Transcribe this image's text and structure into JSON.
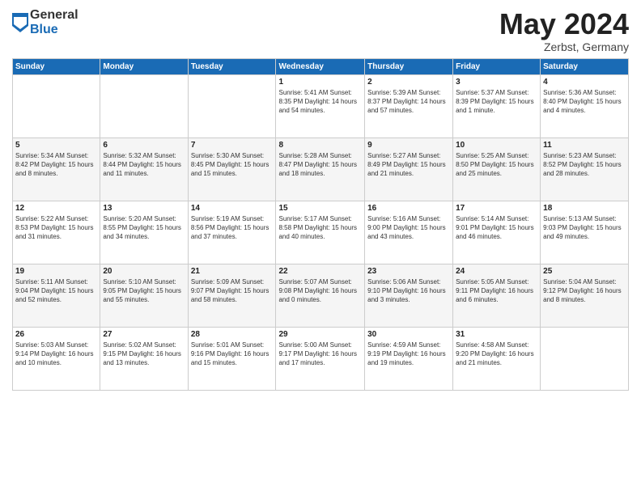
{
  "logo": {
    "general": "General",
    "blue": "Blue"
  },
  "title": {
    "month_year": "May 2024",
    "location": "Zerbst, Germany"
  },
  "days_of_week": [
    "Sunday",
    "Monday",
    "Tuesday",
    "Wednesday",
    "Thursday",
    "Friday",
    "Saturday"
  ],
  "weeks": [
    [
      {
        "day": "",
        "info": ""
      },
      {
        "day": "",
        "info": ""
      },
      {
        "day": "",
        "info": ""
      },
      {
        "day": "1",
        "info": "Sunrise: 5:41 AM\nSunset: 8:35 PM\nDaylight: 14 hours\nand 54 minutes."
      },
      {
        "day": "2",
        "info": "Sunrise: 5:39 AM\nSunset: 8:37 PM\nDaylight: 14 hours\nand 57 minutes."
      },
      {
        "day": "3",
        "info": "Sunrise: 5:37 AM\nSunset: 8:39 PM\nDaylight: 15 hours\nand 1 minute."
      },
      {
        "day": "4",
        "info": "Sunrise: 5:36 AM\nSunset: 8:40 PM\nDaylight: 15 hours\nand 4 minutes."
      }
    ],
    [
      {
        "day": "5",
        "info": "Sunrise: 5:34 AM\nSunset: 8:42 PM\nDaylight: 15 hours\nand 8 minutes."
      },
      {
        "day": "6",
        "info": "Sunrise: 5:32 AM\nSunset: 8:44 PM\nDaylight: 15 hours\nand 11 minutes."
      },
      {
        "day": "7",
        "info": "Sunrise: 5:30 AM\nSunset: 8:45 PM\nDaylight: 15 hours\nand 15 minutes."
      },
      {
        "day": "8",
        "info": "Sunrise: 5:28 AM\nSunset: 8:47 PM\nDaylight: 15 hours\nand 18 minutes."
      },
      {
        "day": "9",
        "info": "Sunrise: 5:27 AM\nSunset: 8:49 PM\nDaylight: 15 hours\nand 21 minutes."
      },
      {
        "day": "10",
        "info": "Sunrise: 5:25 AM\nSunset: 8:50 PM\nDaylight: 15 hours\nand 25 minutes."
      },
      {
        "day": "11",
        "info": "Sunrise: 5:23 AM\nSunset: 8:52 PM\nDaylight: 15 hours\nand 28 minutes."
      }
    ],
    [
      {
        "day": "12",
        "info": "Sunrise: 5:22 AM\nSunset: 8:53 PM\nDaylight: 15 hours\nand 31 minutes."
      },
      {
        "day": "13",
        "info": "Sunrise: 5:20 AM\nSunset: 8:55 PM\nDaylight: 15 hours\nand 34 minutes."
      },
      {
        "day": "14",
        "info": "Sunrise: 5:19 AM\nSunset: 8:56 PM\nDaylight: 15 hours\nand 37 minutes."
      },
      {
        "day": "15",
        "info": "Sunrise: 5:17 AM\nSunset: 8:58 PM\nDaylight: 15 hours\nand 40 minutes."
      },
      {
        "day": "16",
        "info": "Sunrise: 5:16 AM\nSunset: 9:00 PM\nDaylight: 15 hours\nand 43 minutes."
      },
      {
        "day": "17",
        "info": "Sunrise: 5:14 AM\nSunset: 9:01 PM\nDaylight: 15 hours\nand 46 minutes."
      },
      {
        "day": "18",
        "info": "Sunrise: 5:13 AM\nSunset: 9:03 PM\nDaylight: 15 hours\nand 49 minutes."
      }
    ],
    [
      {
        "day": "19",
        "info": "Sunrise: 5:11 AM\nSunset: 9:04 PM\nDaylight: 15 hours\nand 52 minutes."
      },
      {
        "day": "20",
        "info": "Sunrise: 5:10 AM\nSunset: 9:05 PM\nDaylight: 15 hours\nand 55 minutes."
      },
      {
        "day": "21",
        "info": "Sunrise: 5:09 AM\nSunset: 9:07 PM\nDaylight: 15 hours\nand 58 minutes."
      },
      {
        "day": "22",
        "info": "Sunrise: 5:07 AM\nSunset: 9:08 PM\nDaylight: 16 hours\nand 0 minutes."
      },
      {
        "day": "23",
        "info": "Sunrise: 5:06 AM\nSunset: 9:10 PM\nDaylight: 16 hours\nand 3 minutes."
      },
      {
        "day": "24",
        "info": "Sunrise: 5:05 AM\nSunset: 9:11 PM\nDaylight: 16 hours\nand 6 minutes."
      },
      {
        "day": "25",
        "info": "Sunrise: 5:04 AM\nSunset: 9:12 PM\nDaylight: 16 hours\nand 8 minutes."
      }
    ],
    [
      {
        "day": "26",
        "info": "Sunrise: 5:03 AM\nSunset: 9:14 PM\nDaylight: 16 hours\nand 10 minutes."
      },
      {
        "day": "27",
        "info": "Sunrise: 5:02 AM\nSunset: 9:15 PM\nDaylight: 16 hours\nand 13 minutes."
      },
      {
        "day": "28",
        "info": "Sunrise: 5:01 AM\nSunset: 9:16 PM\nDaylight: 16 hours\nand 15 minutes."
      },
      {
        "day": "29",
        "info": "Sunrise: 5:00 AM\nSunset: 9:17 PM\nDaylight: 16 hours\nand 17 minutes."
      },
      {
        "day": "30",
        "info": "Sunrise: 4:59 AM\nSunset: 9:19 PM\nDaylight: 16 hours\nand 19 minutes."
      },
      {
        "day": "31",
        "info": "Sunrise: 4:58 AM\nSunset: 9:20 PM\nDaylight: 16 hours\nand 21 minutes."
      },
      {
        "day": "",
        "info": ""
      }
    ]
  ]
}
